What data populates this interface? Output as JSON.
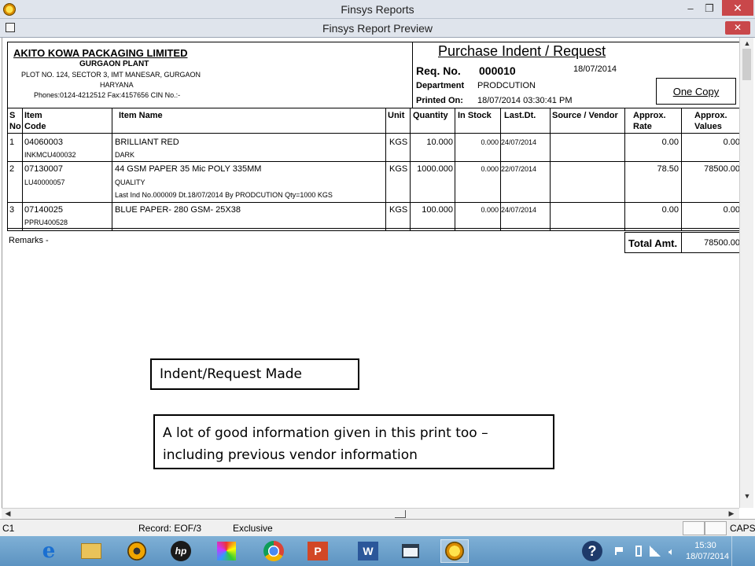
{
  "outer_window": {
    "title": "Finsys Reports",
    "minimize": "–",
    "restore": "❐",
    "close": "✕"
  },
  "inner_window": {
    "title": "Finsys Report Preview",
    "close": "✕"
  },
  "company": {
    "name": "AKITO KOWA PACKAGING LIMITED",
    "plant": "GURGAON PLANT",
    "address": "PLOT NO. 124, SECTOR 3, IMT MANESAR, GURGAON",
    "state": "HARYANA",
    "contact": "Phones:0124-4212512 Fax:4157656 CIN No.:-"
  },
  "doc": {
    "title": "Purchase Indent / Request",
    "req_label": "Req. No.",
    "req_no": "000010",
    "date": "18/07/2014",
    "dept_label": "Department",
    "dept": "PRODCUTION",
    "printed_label": "Printed On:",
    "printed": "18/07/2014 03:30:41 PM",
    "copy": "One Copy"
  },
  "columns": {
    "sno1": "S",
    "sno2": "No",
    "code1": "Item",
    "code2": "Code",
    "name": "Item Name",
    "unit": "Unit",
    "qty": "Quantity",
    "stock": "In Stock",
    "last": "Last.Dt.",
    "src": "Source / Vendor",
    "rate1": "Approx.",
    "rate2": "Rate",
    "val1": "Approx.",
    "val2": "Values"
  },
  "rows": [
    {
      "sno": "1",
      "code": "04060003",
      "code2": "INKMCU400032",
      "name": "BRILLIANT RED",
      "name2": "DARK",
      "name3": "",
      "unit": "KGS",
      "qty": "10.000",
      "stock": "0.000",
      "last": "24/07/2014",
      "rate": "0.00",
      "value": "0.00"
    },
    {
      "sno": "2",
      "code": "07130007",
      "code2": "LU40000057",
      "name": "44 GSM PAPER  35 Mic POLY 335MM",
      "name2": "QUALITY",
      "name3": "Last Ind No.000009 Dt.18/07/2014 By PRODCUTION Qty=1000 KGS",
      "unit": "KGS",
      "qty": "1000.000",
      "stock": "0.000",
      "last": "22/07/2014",
      "rate": "78.50",
      "value": "78500.00"
    },
    {
      "sno": "3",
      "code": "07140025",
      "code2": "PPRU400528",
      "name": "BLUE PAPER- 280 GSM- 25X38",
      "name2": "",
      "name3": "",
      "unit": "KGS",
      "qty": "100.000",
      "stock": "0.000",
      "last": "24/07/2014",
      "rate": "0.00",
      "value": "0.00"
    }
  ],
  "footer": {
    "remarks": "Remarks -",
    "total_label": "Total Amt.",
    "total": "78500.00"
  },
  "annotations": {
    "box1": "Indent/Request Made",
    "box2_line1": "A lot of good information given in this print too –",
    "box2_line2": "including previous vendor information"
  },
  "status": {
    "c1": "C1",
    "record": "Record: EOF/3",
    "mode": "Exclusive",
    "caps": "CAPS"
  },
  "taskbar": {
    "icons": [
      "ie-icon",
      "explorer-icon",
      "media-icon",
      "hp-icon",
      "paint-icon",
      "chrome-icon",
      "powerpoint-icon",
      "word-icon",
      "window-icon",
      "finsys-icon"
    ],
    "word_glyph": "W",
    "ppt_glyph": "P",
    "hp_glyph": "hp",
    "ie_glyph": "e",
    "help_glyph": "?",
    "time": "15:30",
    "date": "18/07/2014"
  }
}
